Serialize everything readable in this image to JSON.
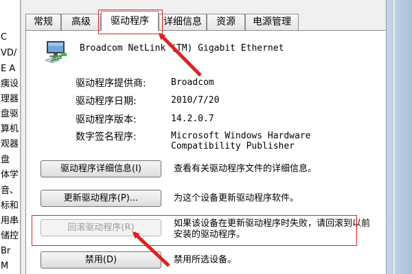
{
  "background_window": {
    "lines": [
      "C",
      "VD/",
      "E A",
      "痍设",
      "理器",
      "盘驱",
      "算机",
      "观器",
      "盘",
      "体学",
      "音、",
      "标和",
      "用串",
      "储控",
      "Br",
      "M"
    ]
  },
  "dialog": {
    "tabs": [
      "常规",
      "高级",
      "驱动程序",
      "详细信息",
      "资源",
      "电源管理"
    ],
    "active_tab": "驱动程序",
    "device_name": "Broadcom NetLink (TM) Gigabit Ethernet",
    "properties": [
      {
        "label": "驱动程序提供商:",
        "value": "Broadcom"
      },
      {
        "label": "驱动程序日期:",
        "value": "2010/7/20"
      },
      {
        "label": "驱动程序版本:",
        "value": "14.2.0.7"
      },
      {
        "label": "数字签名程序:",
        "value": "Microsoft Windows Hardware Compatibility Publisher"
      }
    ],
    "actions": [
      {
        "button": "驱动程序详细信息(I)",
        "description": "查看有关驱动程序文件的详细信息。",
        "enabled": true
      },
      {
        "button": "更新驱动程序(P)...",
        "description": "为这个设备更新驱动程序软件。",
        "enabled": true
      },
      {
        "button": "回滚驱动程序(R)",
        "description": "如果该设备在更新驱动程序时失败，请回滚到以前安装的驱动程序。",
        "enabled": false
      },
      {
        "button": "禁用(D)",
        "description": "禁用所选设备。",
        "enabled": true
      }
    ]
  },
  "colors": {
    "annotation": "#e02020",
    "panel": "#ffffff",
    "chrome": "#f0f0f0",
    "disabled_text": "#9a9a9a"
  }
}
